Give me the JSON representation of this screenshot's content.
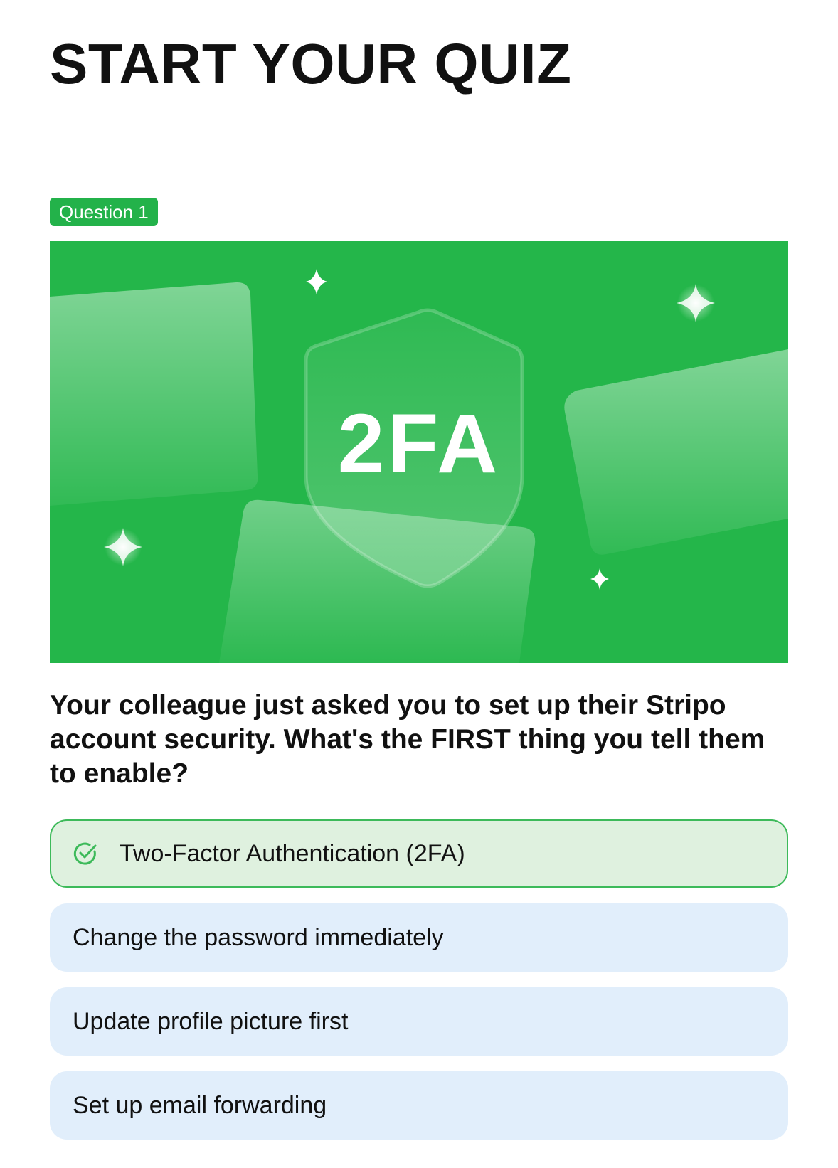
{
  "page": {
    "title": "START YOUR QUIZ"
  },
  "question": {
    "badge": "Question 1",
    "hero_label": "2FA",
    "text": "Your colleague just asked you to set up their Stripo account security. What's the FIRST thing you tell them to enable?"
  },
  "answers": [
    {
      "label": "Two-Factor Authentication (2FA)",
      "state": "correct",
      "icon": "check-circle-icon"
    },
    {
      "label": "Change the password immediately",
      "state": "unselected"
    },
    {
      "label": "Update profile picture first",
      "state": "unselected"
    },
    {
      "label": "Set up email forwarding",
      "state": "unselected"
    }
  ],
  "colors": {
    "accent_green": "#23b24a",
    "correct_bg": "#dff1df",
    "correct_border": "#3dba5a",
    "answer_bg": "#e1eefb",
    "text": "#111111"
  }
}
